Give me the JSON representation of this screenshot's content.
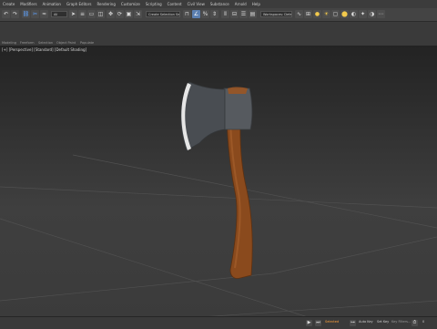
{
  "menu": [
    "Create",
    "Modifiers",
    "Animation",
    "Graph Editors",
    "Rendering",
    "Customize",
    "Scripting",
    "Content",
    "Civil View",
    "Substance",
    "Arnold",
    "Help"
  ],
  "toolbar": {
    "filter_value": "All",
    "selection_set_placeholder": "Create Selection Se",
    "workspace_value": "Workspaces: Default"
  },
  "ribbon": {
    "tabs": [
      "Modeling",
      "Freeform",
      "Selection",
      "Object Paint",
      "Populate"
    ]
  },
  "viewport": {
    "label": "[+] [Perspective] [Standard] [Default Shading]"
  },
  "status": {
    "selected": "Selected",
    "autokey": "Auto Key",
    "setkey": "Set Key",
    "keyfilters": "Key Filters...",
    "frame": "0"
  }
}
